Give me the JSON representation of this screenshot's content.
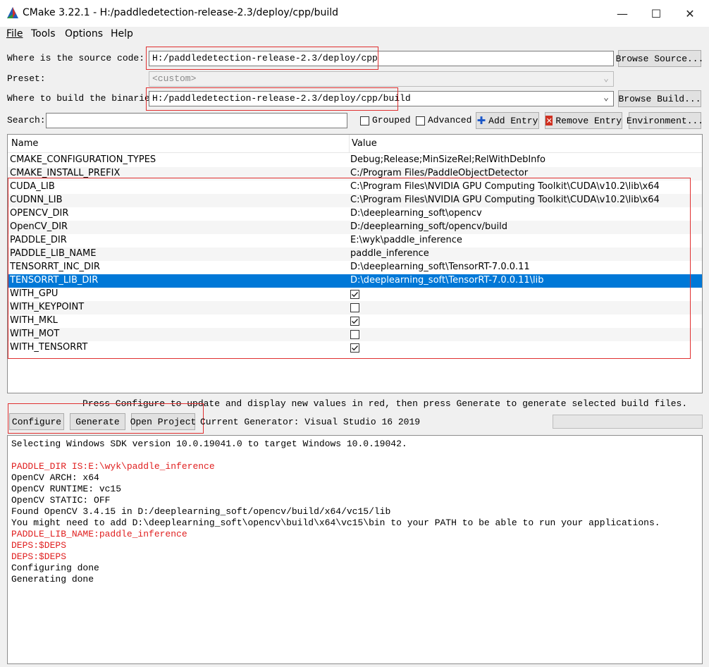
{
  "window": {
    "title": "CMake 3.22.1 - H:/paddledetection-release-2.3/deploy/cpp/build",
    "minimize": "—",
    "maximize": "☐",
    "close": "✕"
  },
  "menu": {
    "file": "File",
    "tools": "Tools",
    "options": "Options",
    "help": "Help"
  },
  "source": {
    "label": "Where is the source code:",
    "value": "H:/paddledetection-release-2.3/deploy/cpp",
    "browse": "Browse Source..."
  },
  "preset": {
    "label": "Preset:",
    "value": "<custom>"
  },
  "binaries": {
    "label": "Where to build the binaries:",
    "value": "H:/paddledetection-release-2.3/deploy/cpp/build",
    "browse": "Browse Build..."
  },
  "search": {
    "label": "Search:",
    "value": "",
    "grouped": "Grouped",
    "advanced": "Advanced",
    "add_entry": "Add Entry",
    "remove_entry": "Remove Entry",
    "environment": "Environment..."
  },
  "table": {
    "headers": {
      "name": "Name",
      "value": "Value"
    },
    "rows": [
      {
        "name": "CMAKE_CONFIGURATION_TYPES",
        "value": "Debug;Release;MinSizeRel;RelWithDebInfo",
        "type": "text"
      },
      {
        "name": "CMAKE_INSTALL_PREFIX",
        "value": "C:/Program Files/PaddleObjectDetector",
        "type": "text"
      },
      {
        "name": "CUDA_LIB",
        "value": "C:\\Program Files\\NVIDIA GPU Computing Toolkit\\CUDA\\v10.2\\lib\\x64",
        "type": "text"
      },
      {
        "name": "CUDNN_LIB",
        "value": "C:\\Program Files\\NVIDIA GPU Computing Toolkit\\CUDA\\v10.2\\lib\\x64",
        "type": "text"
      },
      {
        "name": "OPENCV_DIR",
        "value": "D:\\deeplearning_soft\\opencv",
        "type": "text"
      },
      {
        "name": "OpenCV_DIR",
        "value": "D:/deeplearning_soft/opencv/build",
        "type": "text"
      },
      {
        "name": "PADDLE_DIR",
        "value": "E:\\wyk\\paddle_inference",
        "type": "text"
      },
      {
        "name": "PADDLE_LIB_NAME",
        "value": "paddle_inference",
        "type": "text"
      },
      {
        "name": "TENSORRT_INC_DIR",
        "value": "D:\\deeplearning_soft\\TensorRT-7.0.0.11",
        "type": "text"
      },
      {
        "name": "TENSORRT_LIB_DIR",
        "value": "D:\\deeplearning_soft\\TensorRT-7.0.0.11\\lib",
        "type": "text",
        "selected": true
      },
      {
        "name": "WITH_GPU",
        "value": "",
        "type": "bool",
        "checked": true
      },
      {
        "name": "WITH_KEYPOINT",
        "value": "",
        "type": "bool",
        "checked": false
      },
      {
        "name": "WITH_MKL",
        "value": "",
        "type": "bool",
        "checked": true
      },
      {
        "name": "WITH_MOT",
        "value": "",
        "type": "bool",
        "checked": false
      },
      {
        "name": "WITH_TENSORRT",
        "value": "",
        "type": "bool",
        "checked": true
      }
    ]
  },
  "hint": "Press Configure to update and display new values in red, then press Generate to generate selected build files.",
  "actions": {
    "configure": "Configure",
    "generate": "Generate",
    "open_project": "Open Project",
    "generator": "Current Generator: Visual Studio 16 2019"
  },
  "output": [
    {
      "text": "Selecting Windows SDK version 10.0.19041.0 to target Windows 10.0.19042.",
      "color": "black"
    },
    {
      "text": "",
      "color": "black"
    },
    {
      "text": "PADDLE_DIR IS:E:\\wyk\\paddle_inference",
      "color": "red"
    },
    {
      "text": "OpenCV ARCH: x64",
      "color": "black"
    },
    {
      "text": "OpenCV RUNTIME: vc15",
      "color": "black"
    },
    {
      "text": "OpenCV STATIC: OFF",
      "color": "black"
    },
    {
      "text": "Found OpenCV 3.4.15 in D:/deeplearning_soft/opencv/build/x64/vc15/lib",
      "color": "black"
    },
    {
      "text": "You might need to add D:\\deeplearning_soft\\opencv\\build\\x64\\vc15\\bin to your PATH to be able to run your applications.",
      "color": "black"
    },
    {
      "text": "PADDLE_LIB_NAME:paddle_inference",
      "color": "red"
    },
    {
      "text": "DEPS:$DEPS",
      "color": "red"
    },
    {
      "text": "DEPS:$DEPS",
      "color": "red"
    },
    {
      "text": "Configuring done",
      "color": "black"
    },
    {
      "text": "Generating done",
      "color": "black"
    }
  ],
  "colors": {
    "selection": "#0078d7",
    "output_red": "#e02020",
    "highlight_box": "#e03030"
  }
}
